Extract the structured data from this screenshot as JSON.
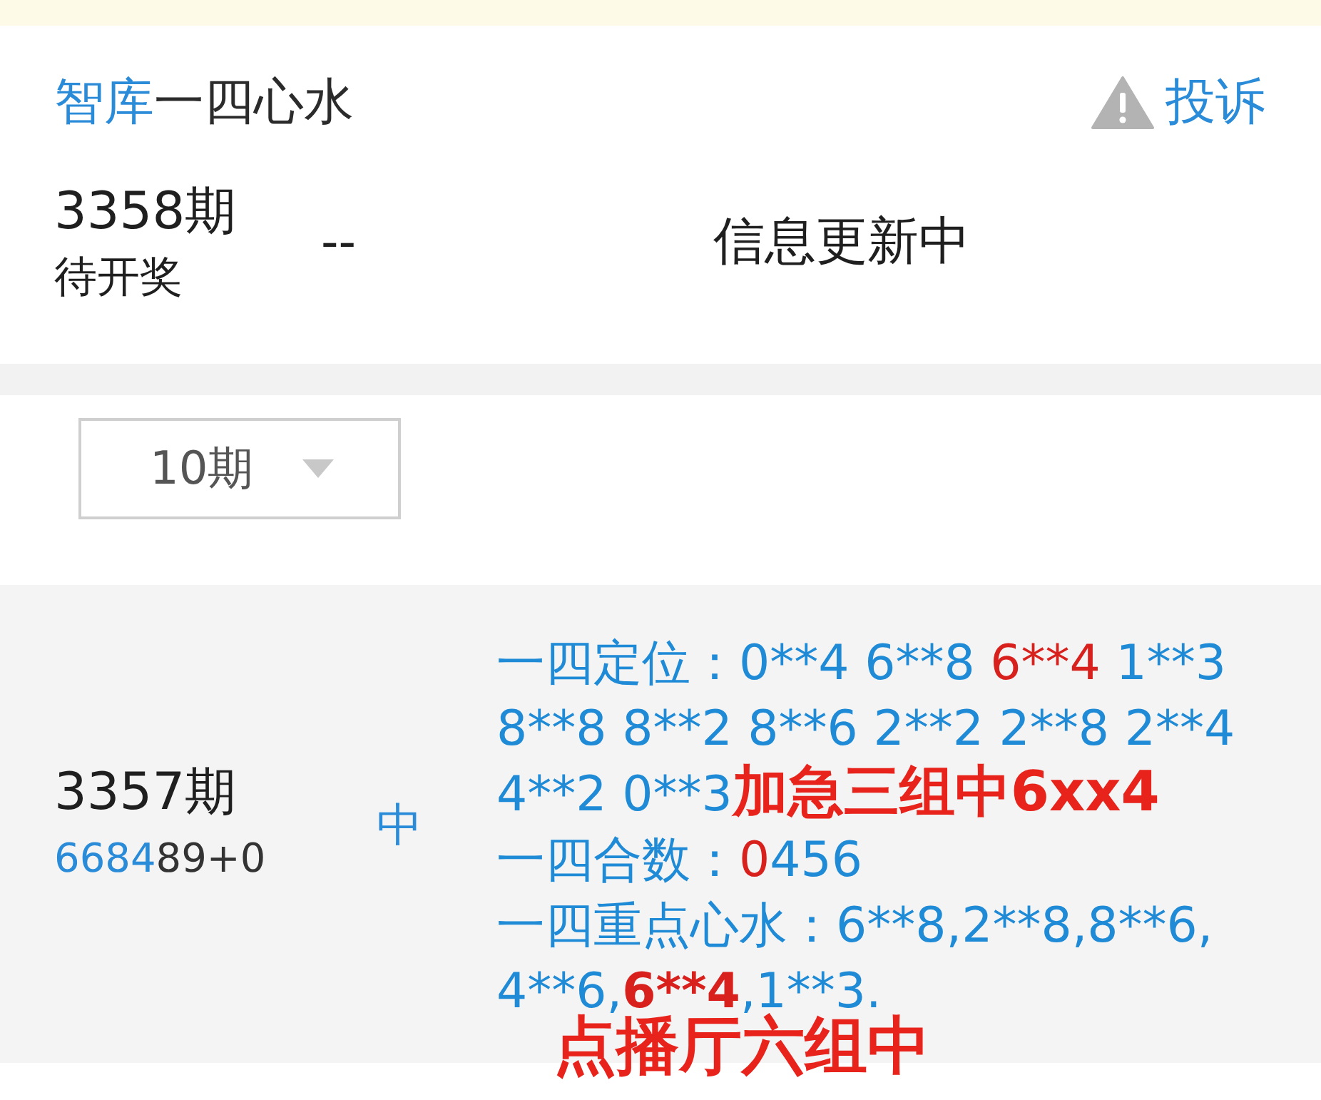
{
  "header": {
    "brand": "智库",
    "title": "一四心水",
    "report": "投诉"
  },
  "current": {
    "issue": "3358期",
    "status": "待开奖",
    "result": "--",
    "message": "信息更新中"
  },
  "filter": {
    "value": "10期"
  },
  "records": [
    {
      "issue": "3357期",
      "numbers": [
        {
          "text": "6684",
          "kind": "match"
        },
        {
          "text": "89+0",
          "kind": "plain"
        }
      ],
      "outcome": "中",
      "predictions": [
        {
          "lines": [
            [
              {
                "text": "一四定位：0**4 6**8 ",
                "kind": "normal"
              },
              {
                "text": "6**4",
                "kind": "hit"
              },
              {
                "text": " 1**3",
                "kind": "normal"
              }
            ],
            [
              {
                "text": "8**8 8**2 8**6 2**2 2**8 2**4",
                "kind": "normal"
              }
            ],
            [
              {
                "text": "4**2 0**3",
                "kind": "normal"
              }
            ]
          ],
          "note": "加急三组中6xx4"
        },
        {
          "lines": [
            [
              {
                "text": "一四合数：",
                "kind": "normal"
              },
              {
                "text": "0",
                "kind": "hit"
              },
              {
                "text": "456",
                "kind": "normal"
              }
            ]
          ]
        },
        {
          "lines": [
            [
              {
                "text": "一四重点心水：6**8,2**8,8**6,",
                "kind": "normal"
              }
            ],
            [
              {
                "text": "4**6,",
                "kind": "normal"
              },
              {
                "text": "6**4",
                "kind": "strong"
              },
              {
                "text": ",1**3.",
                "kind": "normal"
              }
            ]
          ]
        }
      ],
      "note": "点播厅六组中"
    }
  ]
}
